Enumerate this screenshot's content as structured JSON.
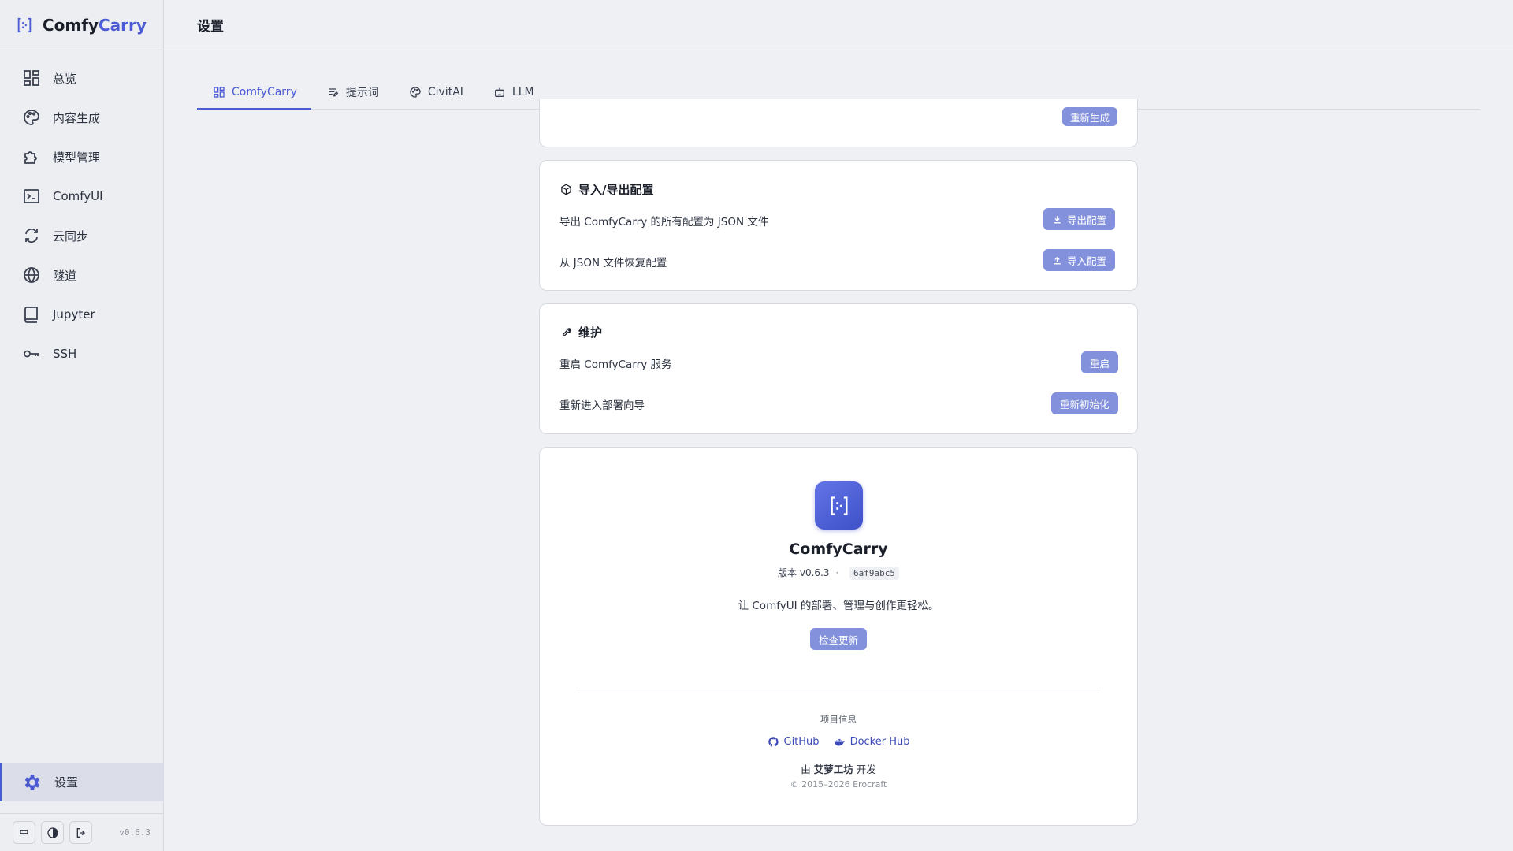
{
  "brand": {
    "name_part1": "Comfy",
    "name_part2": "Carry"
  },
  "sidebar": {
    "items": [
      {
        "label": "总览",
        "icon": "dashboard-icon"
      },
      {
        "label": "内容生成",
        "icon": "palette-icon"
      },
      {
        "label": "模型管理",
        "icon": "puzzle-icon"
      },
      {
        "label": "ComfyUI",
        "icon": "terminal-icon"
      },
      {
        "label": "云同步",
        "icon": "sync-icon"
      },
      {
        "label": "隧道",
        "icon": "globe-icon"
      },
      {
        "label": "Jupyter",
        "icon": "book-icon"
      },
      {
        "label": "SSH",
        "icon": "key-icon"
      }
    ],
    "active_item": {
      "label": "设置",
      "icon": "gear-icon"
    },
    "footer": {
      "lang_label": "中",
      "version": "v0.6.3"
    }
  },
  "header": {
    "title": "设置"
  },
  "tabs": [
    {
      "label": "ComfyCarry",
      "icon": "grid-icon",
      "active": true
    },
    {
      "label": "提示词",
      "icon": "prompt-icon",
      "active": false
    },
    {
      "label": "CivitAI",
      "icon": "palette-icon",
      "active": false
    },
    {
      "label": "LLM",
      "icon": "robot-icon",
      "active": false
    }
  ],
  "partial_card": {
    "button": "重新生成"
  },
  "import_export": {
    "title": "导入/导出配置",
    "export_desc": "导出 ComfyCarry 的所有配置为 JSON 文件",
    "export_button": "导出配置",
    "import_desc": "从 JSON 文件恢复配置",
    "import_button": "导入配置"
  },
  "maintenance": {
    "title": "维护",
    "restart_desc": "重启 ComfyCarry 服务",
    "restart_button": "重启",
    "reinit_desc": "重新进入部署向导",
    "reinit_button": "重新初始化"
  },
  "about": {
    "app_name": "ComfyCarry",
    "version_label": "版本 v0.6.3",
    "separator": "·",
    "commit": "6af9abc5",
    "tagline": "让 ComfyUI 的部署、管理与创作更轻松。",
    "check_update": "检查更新",
    "project_info_label": "项目信息",
    "github": "GitHub",
    "dockerhub": "Docker Hub",
    "made_by_prefix": "由",
    "made_by_name": "艾萝工坊",
    "made_by_suffix": "开发",
    "copyright": "© 2015–2026 Erocraft"
  },
  "colors": {
    "accent": "#4b5bd4",
    "button": "#8391dc"
  }
}
